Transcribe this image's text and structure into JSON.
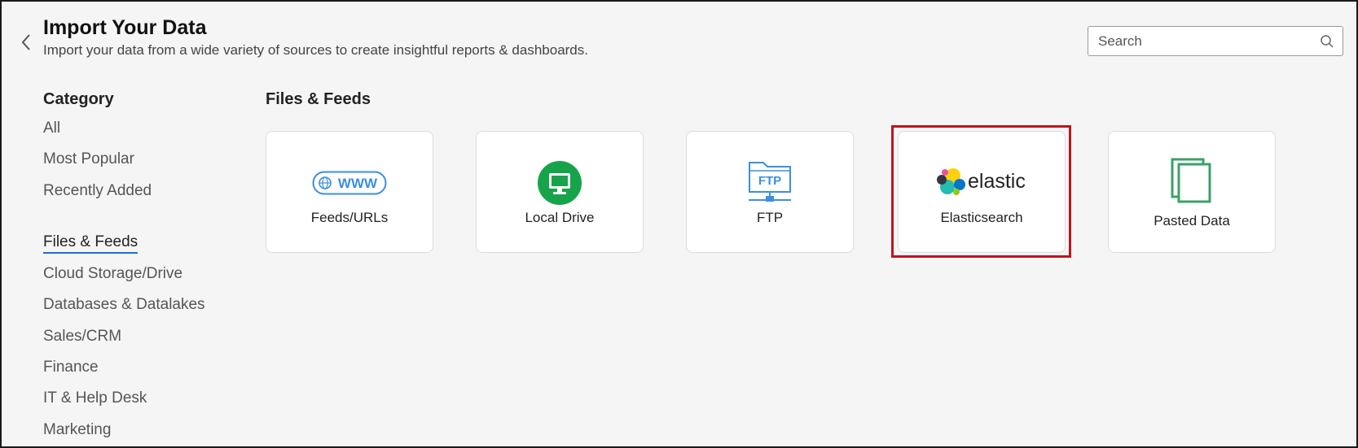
{
  "header": {
    "title": "Import Your Data",
    "subtitle": "Import your data from a wide variety of sources to create insightful reports & dashboards.",
    "back_icon": "chevron-left-icon"
  },
  "search": {
    "placeholder": "Search",
    "value": ""
  },
  "sidebar": {
    "heading": "Category",
    "items": [
      {
        "label": "All"
      },
      {
        "label": "Most Popular"
      },
      {
        "label": "Recently Added"
      },
      {
        "label": "Files & Feeds",
        "active": true
      },
      {
        "label": "Cloud Storage/Drive"
      },
      {
        "label": "Databases & Datalakes"
      },
      {
        "label": "Sales/CRM"
      },
      {
        "label": "Finance"
      },
      {
        "label": "IT & Help Desk"
      },
      {
        "label": "Marketing"
      }
    ]
  },
  "main": {
    "section_title": "Files & Feeds",
    "cards": [
      {
        "label": "Feeds/URLs",
        "icon": "www-globe-icon"
      },
      {
        "label": "Local Drive",
        "icon": "monitor-icon"
      },
      {
        "label": "FTP",
        "icon": "ftp-folder-icon",
        "icon_text": "FTP"
      },
      {
        "label": "Elasticsearch",
        "icon": "elastic-logo",
        "logo_text": "elastic",
        "highlighted": true
      },
      {
        "label": "Pasted Data",
        "icon": "copy-icon"
      }
    ]
  },
  "colors": {
    "accent": "#1e6fd9",
    "highlight": "#c3121e",
    "local_drive": "#17a34a",
    "ftp": "#3b8fe0",
    "pasted": "#3ca067"
  }
}
